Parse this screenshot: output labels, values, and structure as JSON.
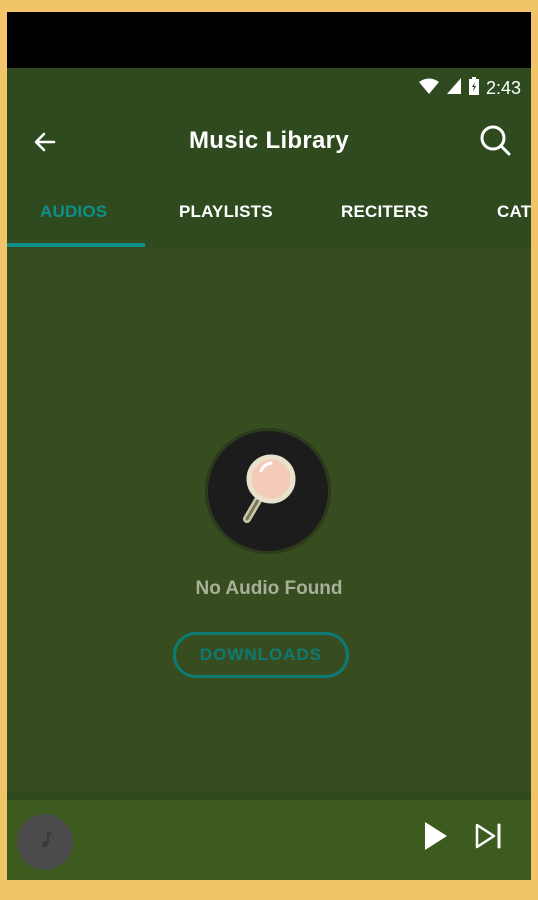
{
  "status": {
    "time": "2:43"
  },
  "app_bar": {
    "title": "Music Library"
  },
  "tabs": [
    {
      "label": "AUDIOS",
      "active": true
    },
    {
      "label": "PLAYLISTS",
      "active": false
    },
    {
      "label": "RECITERS",
      "active": false
    },
    {
      "label": "CAT",
      "active": false
    }
  ],
  "empty_state": {
    "message": "No Audio Found",
    "button_label": "DOWNLOADS"
  },
  "colors": {
    "primary": "#2f4a1f",
    "accent": "#0f8f8a",
    "content": "#374d1f",
    "frame": "#f2c46a"
  },
  "icons": {
    "back": "arrow-left-icon",
    "search": "search-icon",
    "empty": "magnifier-icon",
    "thumb": "music-note-icon",
    "play": "play-icon",
    "next": "skip-next-icon",
    "wifi": "wifi-icon",
    "signal": "signal-icon",
    "battery": "battery-icon"
  }
}
